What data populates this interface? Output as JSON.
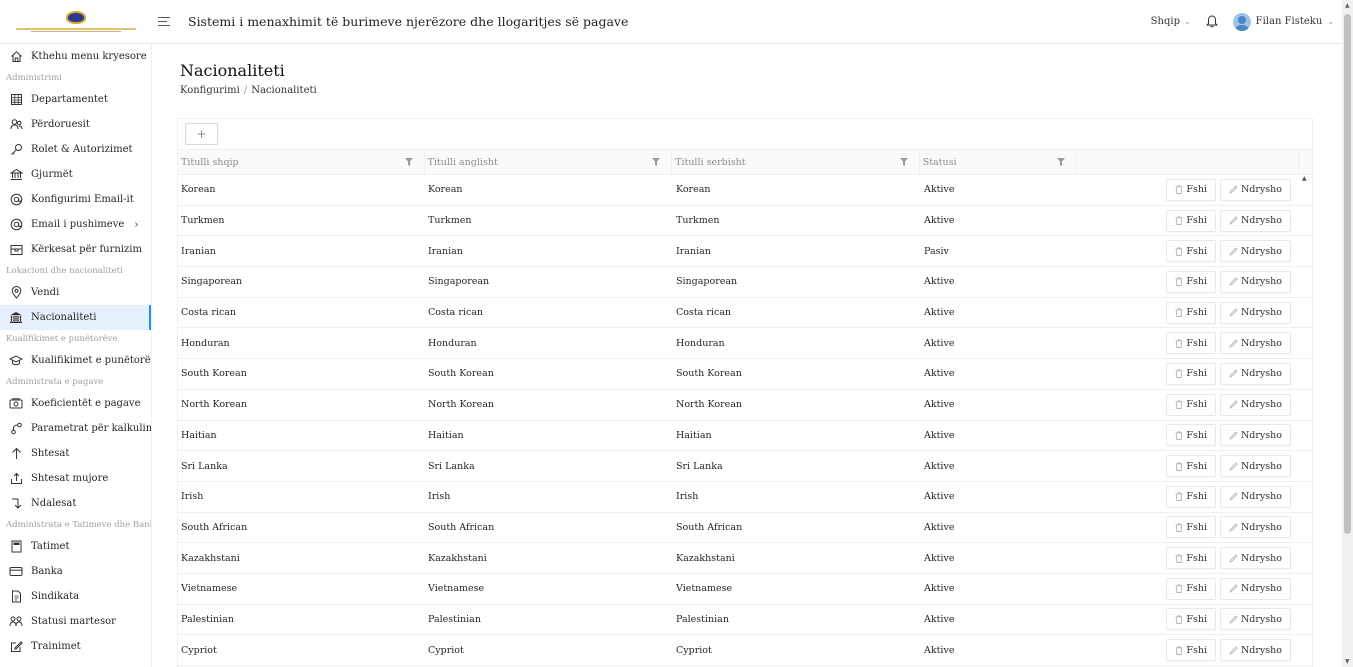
{
  "header": {
    "app_title": "Sistemi i menaxhimit të burimeve njerëzore dhe llogaritjes së pagave",
    "language": "Shqip",
    "user_name": "Filan Fisteku"
  },
  "sidebar": {
    "entries": [
      {
        "kind": "item",
        "label": "Kthehu menu kryesore",
        "icon": "home-icon"
      },
      {
        "kind": "group",
        "label": "Administrimi"
      },
      {
        "kind": "item",
        "label": "Departamentet",
        "icon": "table-icon"
      },
      {
        "kind": "item",
        "label": "Përdoruesit",
        "icon": "users-icon"
      },
      {
        "kind": "item",
        "label": "Rolet & Autorizimet",
        "icon": "key-icon"
      },
      {
        "kind": "item",
        "label": "Gjurmët",
        "icon": "bank-icon"
      },
      {
        "kind": "item",
        "label": "Konfigurimi Email-it",
        "icon": "at-icon"
      },
      {
        "kind": "item",
        "label": "Email i pushimeve",
        "icon": "at-icon",
        "arrow": true
      },
      {
        "kind": "item",
        "label": "Kërkesat për furnizim",
        "icon": "box-icon"
      },
      {
        "kind": "group",
        "label": "Lokacioni dhe nacionaliteti"
      },
      {
        "kind": "item",
        "label": "Vendi",
        "icon": "location-icon"
      },
      {
        "kind": "item",
        "label": "Nacionaliteti",
        "icon": "institution-icon",
        "active": true
      },
      {
        "kind": "group",
        "label": "Kualifikimet e punëtorëve"
      },
      {
        "kind": "item",
        "label": "Kualifikimet e punëtorëve",
        "icon": "graduation-icon"
      },
      {
        "kind": "group",
        "label": "Administrata e pagave"
      },
      {
        "kind": "item",
        "label": "Koeficientët e pagave",
        "icon": "money-icon"
      },
      {
        "kind": "item",
        "label": "Parametrat për kalkulim",
        "icon": "branches-icon"
      },
      {
        "kind": "item",
        "label": "Shtesat",
        "icon": "arrow-up-icon"
      },
      {
        "kind": "item",
        "label": "Shtesat mujore",
        "icon": "upload-icon"
      },
      {
        "kind": "item",
        "label": "Ndalesat",
        "icon": "enter-icon"
      },
      {
        "kind": "group",
        "label": "Administrata e Tatimeve dhe Banka"
      },
      {
        "kind": "item",
        "label": "Tatimet",
        "icon": "calculator-icon"
      },
      {
        "kind": "item",
        "label": "Banka",
        "icon": "card-icon"
      },
      {
        "kind": "item",
        "label": "Sindikata",
        "icon": "file-icon"
      },
      {
        "kind": "item",
        "label": "Statusi martesor",
        "icon": "couple-icon"
      },
      {
        "kind": "item",
        "label": "Trainimet",
        "icon": "edit-square-icon"
      }
    ]
  },
  "page": {
    "title": "Nacionaliteti",
    "breadcrumb": [
      "Konfigurimi",
      "Nacionaliteti"
    ],
    "add_label": "+"
  },
  "table": {
    "columns": [
      "Titulli shqip",
      "Titulli anglisht",
      "Titulli serbisht",
      "Statusi"
    ],
    "delete_label": "Fshi",
    "edit_label": "Ndrysho",
    "rows": [
      [
        "Korean",
        "Korean",
        "Korean",
        "Aktive"
      ],
      [
        "Turkmen",
        "Turkmen",
        "Turkmen",
        "Aktive"
      ],
      [
        "Iranian",
        "Iranian",
        "Iranian",
        "Pasiv"
      ],
      [
        "Singaporean",
        "Singaporean",
        "Singaporean",
        "Aktive"
      ],
      [
        "Costa rican",
        "Costa rican",
        "Costa rican",
        "Aktive"
      ],
      [
        "Honduran",
        "Honduran",
        "Honduran",
        "Aktive"
      ],
      [
        "South Korean",
        "South Korean",
        "South Korean",
        "Aktive"
      ],
      [
        "North Korean",
        "North Korean",
        "North Korean",
        "Aktive"
      ],
      [
        "Haitian",
        "Haitian",
        "Haitian",
        "Aktive"
      ],
      [
        "Sri Lanka",
        "Sri Lanka",
        "Sri Lanka",
        "Aktive"
      ],
      [
        "Irish",
        "Irish",
        "Irish",
        "Aktive"
      ],
      [
        "South African",
        "South African",
        "South African",
        "Aktive"
      ],
      [
        "Kazakhstani",
        "Kazakhstani",
        "Kazakhstani",
        "Aktive"
      ],
      [
        "Vietnamese",
        "Vietnamese",
        "Vietnamese",
        "Aktive"
      ],
      [
        "Palestinian",
        "Palestinian",
        "Palestinian",
        "Aktive"
      ],
      [
        "Cypriot",
        "Cypriot",
        "Cypriot",
        "Aktive"
      ]
    ]
  }
}
